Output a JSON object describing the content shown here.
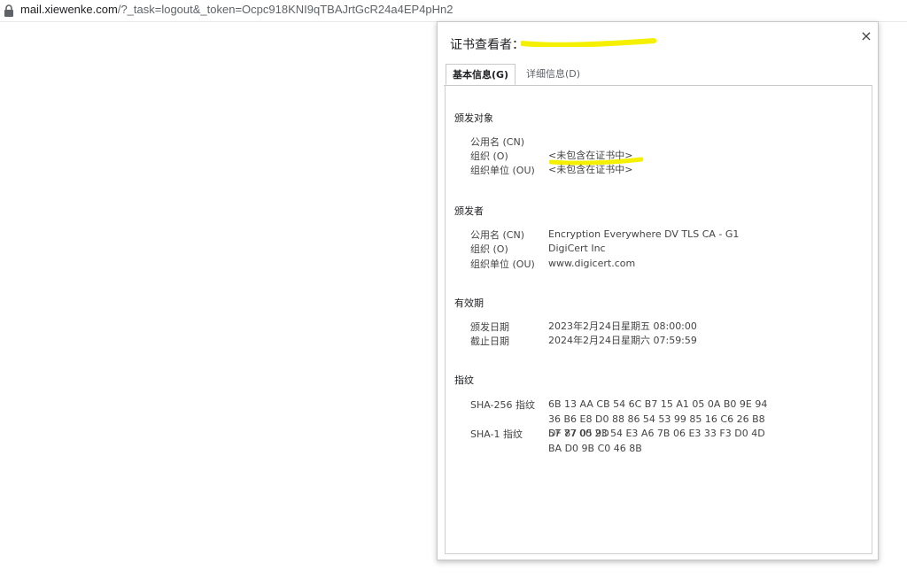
{
  "browser": {
    "url_host": "mail.xiewenke.com",
    "url_rest": "/?_task=logout&_token=Ocpc918KNI9qTBAJrtGcR24a4EP4pHn2",
    "lock_icon": "lock-icon"
  },
  "dialog": {
    "title": "证书查看者：",
    "close_label": "×",
    "tabs": [
      {
        "label": "基本信息(G)",
        "active": true
      },
      {
        "label": "详细信息(D)",
        "active": false
      }
    ],
    "sections": {
      "subject": {
        "title": "颁发对象",
        "rows": [
          {
            "key": "公用名 (CN)",
            "value": ""
          },
          {
            "key": "组织 (O)",
            "value": "<未包含在证书中>"
          },
          {
            "key": "组织单位 (OU)",
            "value": "<未包含在证书中>"
          }
        ]
      },
      "issuer": {
        "title": "颁发者",
        "rows": [
          {
            "key": "公用名 (CN)",
            "value": "Encryption Everywhere DV TLS CA - G1"
          },
          {
            "key": "组织 (O)",
            "value": "DigiCert Inc"
          },
          {
            "key": "组织单位 (OU)",
            "value": "www.digicert.com"
          }
        ]
      },
      "validity": {
        "title": "有效期",
        "rows": [
          {
            "key": "颁发日期",
            "value": "2023年2月24日星期五 08:00:00"
          },
          {
            "key": "截止日期",
            "value": "2024年2月24日星期六 07:59:59"
          }
        ]
      },
      "fingerprints": {
        "title": "指纹",
        "rows": [
          {
            "key": "SHA-256 指纹",
            "value": "6B 13 AA CB 54 6C B7 15 A1 05 0A B0 9E 94 36 B6 E8 D0 88 86 54 53 99 85 16 C6 26 B8 DF 87 05 9D"
          },
          {
            "key": "SHA-1 指纹",
            "value": "57 77 00 23 54 E3 A6 7B 06 E3 33 F3 D0 4D BA D0 9B C0 46 8B"
          }
        ]
      }
    },
    "highlight_color": "#f5f000"
  }
}
